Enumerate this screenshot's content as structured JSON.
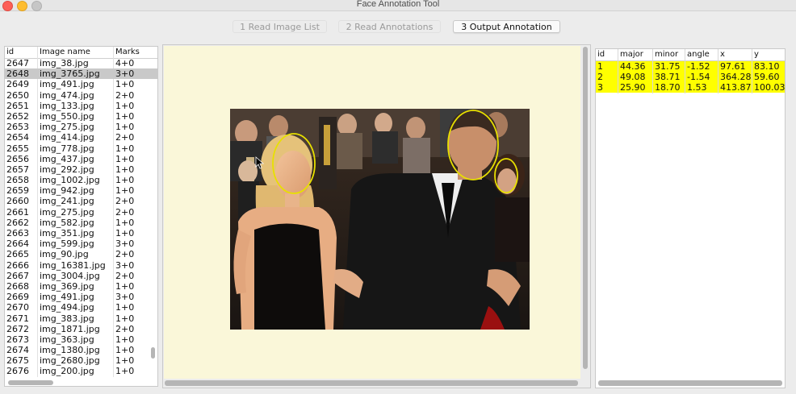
{
  "window": {
    "title": "Face Annotation Tool"
  },
  "tabs": [
    {
      "label": "1 Read Image List",
      "active": false
    },
    {
      "label": "2 Read Annotations",
      "active": false
    },
    {
      "label": "3 Output Annotation",
      "active": true
    }
  ],
  "image_list": {
    "columns": [
      "id",
      "Image name",
      "Marks"
    ],
    "selected_id": "2648",
    "rows": [
      {
        "id": "2647",
        "name": "img_38.jpg",
        "marks": "4+0"
      },
      {
        "id": "2648",
        "name": "img_3765.jpg",
        "marks": "3+0"
      },
      {
        "id": "2649",
        "name": "img_491.jpg",
        "marks": "1+0"
      },
      {
        "id": "2650",
        "name": "img_474.jpg",
        "marks": "2+0"
      },
      {
        "id": "2651",
        "name": "img_133.jpg",
        "marks": "1+0"
      },
      {
        "id": "2652",
        "name": "img_550.jpg",
        "marks": "1+0"
      },
      {
        "id": "2653",
        "name": "img_275.jpg",
        "marks": "1+0"
      },
      {
        "id": "2654",
        "name": "img_414.jpg",
        "marks": "2+0"
      },
      {
        "id": "2655",
        "name": "img_778.jpg",
        "marks": "1+0"
      },
      {
        "id": "2656",
        "name": "img_437.jpg",
        "marks": "1+0"
      },
      {
        "id": "2657",
        "name": "img_292.jpg",
        "marks": "1+0"
      },
      {
        "id": "2658",
        "name": "img_1002.jpg",
        "marks": "1+0"
      },
      {
        "id": "2659",
        "name": "img_942.jpg",
        "marks": "1+0"
      },
      {
        "id": "2660",
        "name": "img_241.jpg",
        "marks": "2+0"
      },
      {
        "id": "2661",
        "name": "img_275.jpg",
        "marks": "2+0"
      },
      {
        "id": "2662",
        "name": "img_582.jpg",
        "marks": "1+0"
      },
      {
        "id": "2663",
        "name": "img_351.jpg",
        "marks": "1+0"
      },
      {
        "id": "2664",
        "name": "img_599.jpg",
        "marks": "3+0"
      },
      {
        "id": "2665",
        "name": "img_90.jpg",
        "marks": "2+0"
      },
      {
        "id": "2666",
        "name": "img_16381.jpg",
        "marks": "3+0"
      },
      {
        "id": "2667",
        "name": "img_3004.jpg",
        "marks": "2+0"
      },
      {
        "id": "2668",
        "name": "img_369.jpg",
        "marks": "1+0"
      },
      {
        "id": "2669",
        "name": "img_491.jpg",
        "marks": "3+0"
      },
      {
        "id": "2670",
        "name": "img_494.jpg",
        "marks": "1+0"
      },
      {
        "id": "2671",
        "name": "img_383.jpg",
        "marks": "1+0"
      },
      {
        "id": "2672",
        "name": "img_1871.jpg",
        "marks": "2+0"
      },
      {
        "id": "2673",
        "name": "img_363.jpg",
        "marks": "1+0"
      },
      {
        "id": "2674",
        "name": "img_1380.jpg",
        "marks": "1+0"
      },
      {
        "id": "2675",
        "name": "img_2680.jpg",
        "marks": "1+0"
      },
      {
        "id": "2676",
        "name": "img_200.jpg",
        "marks": "1+0"
      }
    ]
  },
  "annotations": {
    "columns": [
      "id",
      "major",
      "minor",
      "angle",
      "x",
      "y"
    ],
    "highlight_color": "#ffff00",
    "ellipse_color": "#e8e000",
    "rows": [
      {
        "id": "1",
        "major": "44.36",
        "minor": "31.75",
        "angle": "-1.52",
        "x": "97.61",
        "y": "83.10"
      },
      {
        "id": "2",
        "major": "49.08",
        "minor": "38.71",
        "angle": "-1.54",
        "x": "364.28",
        "y": "59.60"
      },
      {
        "id": "3",
        "major": "25.90",
        "minor": "18.70",
        "angle": "1.53",
        "x": "413.87",
        "y": "100.03"
      }
    ]
  },
  "colors": {
    "canvas_background": "#faf7d9",
    "selected_row": "#c9c9c9"
  }
}
